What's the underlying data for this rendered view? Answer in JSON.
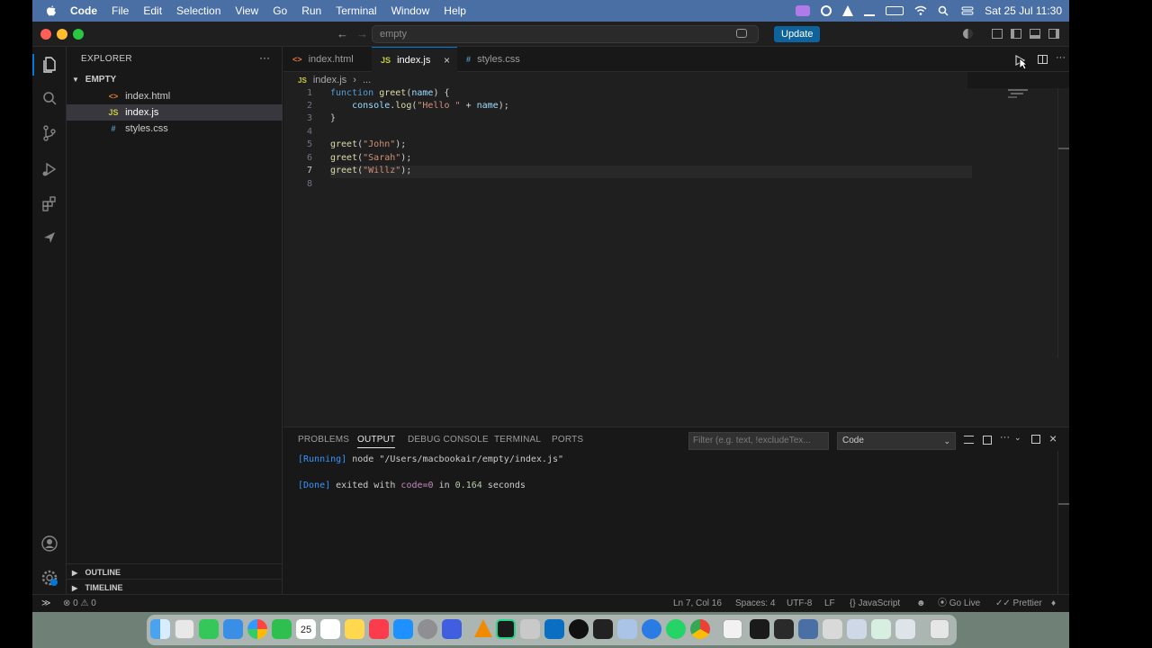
{
  "menubar": {
    "app_name": "Code",
    "items": [
      "File",
      "Edit",
      "Selection",
      "View",
      "Go",
      "Run",
      "Terminal",
      "Window",
      "Help"
    ],
    "clock": "Sat 25 Jul  11:30"
  },
  "titlebar": {
    "search_text": "empty",
    "update_label": "Update"
  },
  "sidebar": {
    "title": "EXPLORER",
    "folder": "EMPTY",
    "files": [
      {
        "name": "index.html",
        "icon": "<>"
      },
      {
        "name": "index.js",
        "icon": "JS"
      },
      {
        "name": "styles.css",
        "icon": "#"
      }
    ],
    "outline": "OUTLINE",
    "timeline": "TIMELINE"
  },
  "tabs": [
    {
      "label": "index.html",
      "icon": "<>"
    },
    {
      "label": "index.js",
      "icon": "JS"
    },
    {
      "label": "styles.css",
      "icon": "#"
    }
  ],
  "breadcrumb": {
    "file": "index.js",
    "rest": "..."
  },
  "editor": {
    "line_numbers": [
      "1",
      "2",
      "3",
      "4",
      "5",
      "6",
      "7",
      "8"
    ],
    "current_line": 7
  },
  "panel": {
    "tabs": [
      "PROBLEMS",
      "OUTPUT",
      "DEBUG CONSOLE",
      "TERMINAL",
      "PORTS"
    ],
    "active_tab": "OUTPUT",
    "filter_placeholder": "Filter (e.g. text, !excludeTex...",
    "channel": "Code",
    "output": {
      "running_tag": "[Running]",
      "running_cmd": "node \"/Users/macbookair/empty/index.js\"",
      "done_tag": "[Done]",
      "done_text_1": "exited with",
      "done_code": "code=0",
      "done_text_2": "in",
      "done_time": "0.164",
      "done_text_3": "seconds"
    }
  },
  "statusbar": {
    "errors": "0",
    "warnings": "0",
    "position": "Ln 7, Col 16",
    "spaces": "Spaces: 4",
    "encoding": "UTF-8",
    "eol": "LF",
    "language": "JavaScript",
    "golive": "Go Live",
    "prettier": "Prettier"
  },
  "dock": {
    "calendar_day": "25"
  },
  "colors": {
    "accent": "#0078d4",
    "update_button": "#0e639c",
    "menubar": "#4a6fa5",
    "editor_bg": "#1f1f1f",
    "sidebar_bg": "#181818"
  }
}
